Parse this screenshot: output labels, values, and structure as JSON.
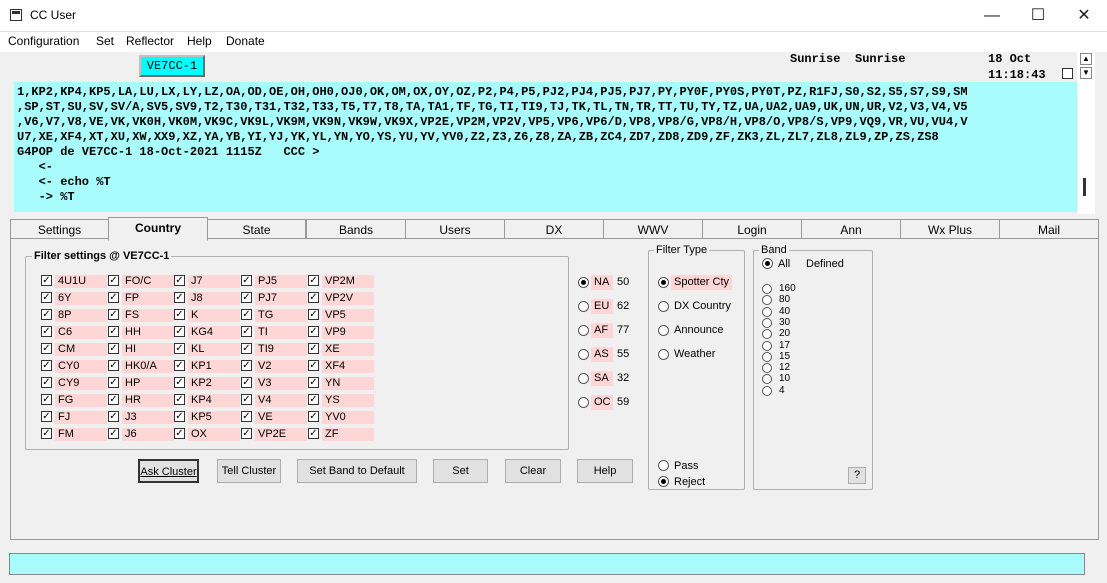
{
  "window": {
    "title": "CC User",
    "minimize": "—",
    "maximize": "☐",
    "close": "✕"
  },
  "menu": [
    "Configuration",
    "Set",
    "Reflector",
    "Help",
    "Donate"
  ],
  "callsign": "VE7CC-1",
  "header": {
    "sunrise1": "Sunrise",
    "sunrise2": "Sunrise",
    "date": "18 Oct",
    "time": "11:18:43"
  },
  "console": [
    "1,KP2,KP4,KP5,LA,LU,LX,LY,LZ,OA,OD,OE,OH,OH0,OJ0,OK,OM,OX,OY,OZ,P2,P4,P5,PJ2,PJ4,PJ5,PJ7,PY,PY0F,PY0S,PY0T,PZ,R1FJ,S0,S2,S5,S7,S9,SM",
    ",SP,ST,SU,SV,SV/A,SV5,SV9,T2,T30,T31,T32,T33,T5,T7,T8,TA,TA1,TF,TG,TI,TI9,TJ,TK,TL,TN,TR,TT,TU,TY,TZ,UA,UA2,UA9,UK,UN,UR,V2,V3,V4,V5",
    ",V6,V7,V8,VE,VK,VK0H,VK0M,VK9C,VK9L,VK9M,VK9N,VK9W,VK9X,VP2E,VP2M,VP2V,VP5,VP6,VP6/D,VP8,VP8/G,VP8/H,VP8/O,VP8/S,VP9,VQ9,VR,VU,VU4,V",
    "U7,XE,XF4,XT,XU,XW,XX9,XZ,YA,YB,YI,YJ,YK,YL,YN,YO,YS,YU,YV,YV0,Z2,Z3,Z6,Z8,ZA,ZB,ZC4,ZD7,ZD8,ZD9,ZF,ZK3,ZL,ZL7,ZL8,ZL9,ZP,ZS,ZS8",
    "G4POP de VE7CC-1 18-Oct-2021 1115Z   CCC >",
    "   <-",
    "   <- echo %T",
    "   -> %T"
  ],
  "tabs": [
    "Settings",
    "Country",
    "State",
    "Bands",
    "Users",
    "DX",
    "WWV",
    "Login",
    "Ann",
    "Wx Plus",
    "Mail"
  ],
  "active_tab": "Country",
  "filter": {
    "legend": "Filter settings @ VE7CC-1",
    "columns": [
      [
        "4U1U",
        "6Y",
        "8P",
        "C6",
        "CM",
        "CY0",
        "CY9",
        "FG",
        "FJ",
        "FM"
      ],
      [
        "FO/C",
        "FP",
        "FS",
        "HH",
        "HI",
        "HK0/A",
        "HP",
        "HR",
        "J3",
        "J6"
      ],
      [
        "J7",
        "J8",
        "K",
        "KG4",
        "KL",
        "KP1",
        "KP2",
        "KP4",
        "KP5",
        "OX"
      ],
      [
        "PJ5",
        "PJ7",
        "TG",
        "TI",
        "TI9",
        "V2",
        "V3",
        "V4",
        "VE",
        "VP2E"
      ],
      [
        "VP2M",
        "VP2V",
        "VP5",
        "VP9",
        "XE",
        "XF4",
        "YN",
        "YS",
        "YV0",
        "ZF"
      ]
    ]
  },
  "continents": [
    {
      "name": "NA",
      "count": "50",
      "selected": true
    },
    {
      "name": "EU",
      "count": "62",
      "selected": false
    },
    {
      "name": "AF",
      "count": "77",
      "selected": false
    },
    {
      "name": "AS",
      "count": "55",
      "selected": false
    },
    {
      "name": "SA",
      "count": "32",
      "selected": false
    },
    {
      "name": "OC",
      "count": "59",
      "selected": false
    }
  ],
  "filter_type": {
    "legend": "Filter Type",
    "options": [
      {
        "label": "Spotter Cty",
        "selected": true
      },
      {
        "label": "DX Country",
        "selected": false
      },
      {
        "label": "Announce",
        "selected": false
      },
      {
        "label": "Weather",
        "selected": false
      }
    ],
    "pass": "Pass",
    "reject": "Reject"
  },
  "band": {
    "legend": "Band",
    "all": "All",
    "defined": "Defined",
    "items": [
      "160",
      "80",
      "40",
      "30",
      "20",
      "17",
      "15",
      "12",
      "10",
      "4"
    ],
    "help": "?"
  },
  "buttons": {
    "ask": "Ask Cluster",
    "tell": "Tell Cluster",
    "default": "Set Band to Default",
    "set": "Set",
    "clear": "Clear",
    "help": "Help"
  },
  "status": ""
}
